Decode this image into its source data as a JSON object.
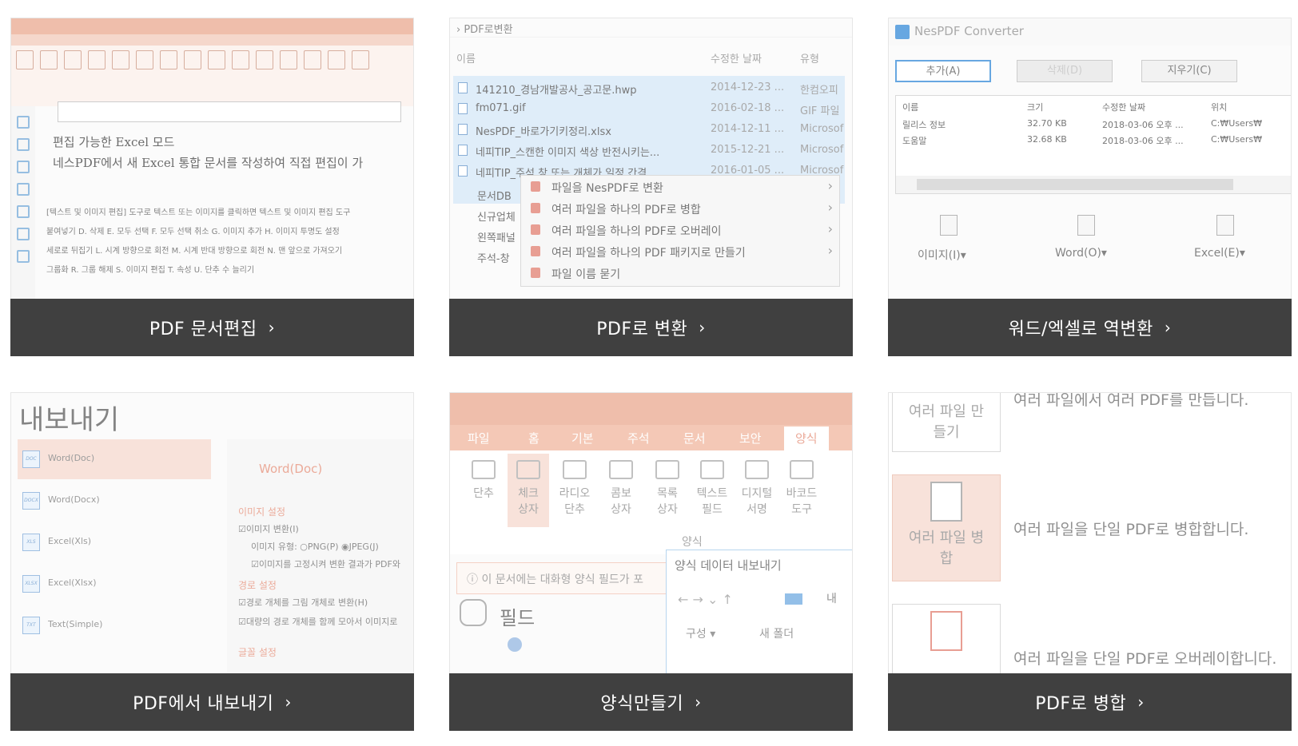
{
  "cards": [
    {
      "label": "PDF 문서편집"
    },
    {
      "label": "PDF로 변환"
    },
    {
      "label": "워드/엑셀로 역변환"
    },
    {
      "label": "PDF에서 내보내기"
    },
    {
      "label": "양식만들기"
    },
    {
      "label": "PDF로 병합"
    }
  ],
  "chevron": "›",
  "editor": {
    "heading1": "편집 가능한 Excel 모드",
    "heading2": "네스PDF에서 새 Excel 통합 문서를 작성하여 직접 편집이 가",
    "lines": [
      "[텍스트 및 이미지 편집] 도구로 텍스트 또는 이미지를 클릭하면 텍스트 및 이미지 편집 도구",
      "붙여넣기 D. 삭제 E. 모두 선택 F. 모두 선택 취소 G. 이미지 추가 H. 이미지 투명도 설정",
      "세로로 뒤집기 L. 시계 방향으로 회전 M. 시계 반대 방향으로 회전 N. 맨 앞으로 가져오기",
      "그룹화 R. 그룹 해제 S. 이미지 편집 T. 속성 U. 단추 수 늘리기"
    ]
  },
  "explorer": {
    "breadcrumb": "PDF로변환",
    "col_name": "이름",
    "col_date": "수정한 날짜",
    "col_type": "유형",
    "files": [
      {
        "name": "141210_경남개발공사_공고문.hwp",
        "date": "2014-12-23 ...",
        "type": "한컴오피"
      },
      {
        "name": "fm071.gif",
        "date": "2016-02-18 ...",
        "type": "GIF 파일"
      },
      {
        "name": "NesPDF_바로가기키정리.xlsx",
        "date": "2014-12-11 ...",
        "type": "Microsof"
      },
      {
        "name": "네피TIP_스캔한 이미지 색상 반전시키는...",
        "date": "2015-12-21 ...",
        "type": "Microsof"
      },
      {
        "name": "네피TIP_주석 창 또는 개체가 일정 간격...",
        "date": "2016-01-05 ...",
        "type": "Microsof"
      }
    ],
    "left_names": [
      "문서DB",
      "신규업체",
      "왼쪽패널",
      "주석-창"
    ],
    "menu": [
      "파일을 NesPDF로 변환",
      "여러 파일을 하나의 PDF로 병합",
      "여러 파일을 하나의 PDF로 오버레이",
      "여러 파일을 하나의 PDF 패키지로 만들기",
      "파일 이름 묻기"
    ]
  },
  "converter": {
    "title": "NesPDF Converter",
    "btn_add": "추가(A)",
    "btn_delete": "삭제(D)",
    "btn_clear": "지우기(C)",
    "col_name": "이름",
    "col_size": "크기",
    "col_date": "수정한 날짜",
    "col_loc": "위치",
    "rows": [
      {
        "name": "릴리스 정보",
        "size": "32.70 KB",
        "date": "2018-03-06 오후 ...",
        "loc": "C:₩Users₩"
      },
      {
        "name": "도움말",
        "size": "32.68 KB",
        "date": "2018-03-06 오후 ...",
        "loc": "C:₩Users₩"
      }
    ],
    "out_image": "이미지(I)▾",
    "out_word": "Word(O)▾",
    "out_excel": "Excel(E)▾"
  },
  "export": {
    "title": "내보내기",
    "formats": [
      "Word(Doc)",
      "Word(Docx)",
      "Excel(Xls)",
      "Excel(Xlsx)",
      "Text(Simple)"
    ],
    "format_icons": [
      "DOC",
      "DOCX",
      "XLS",
      "XLSX",
      "TXT"
    ],
    "selected_format": "Word(Doc)",
    "sec_image": "이미지 설정",
    "opt_image_convert": "☑이미지 변환(I)",
    "opt_image_type": "이미지 유형:  ○PNG(P)   ◉JPEG(J)",
    "opt_image_fix": "☑이미지를 고정시켜 변환 결과가 PDF와",
    "sec_path": "경로 설정",
    "opt_path_convert": "☑경로 개체를 그림 개체로 변환(H)",
    "opt_path_merge": "☑대량의 경로 개체를 함께 모아서 이미지로",
    "sec_font": "글꼴 설정"
  },
  "forms": {
    "tabs": [
      "파일",
      "홈",
      "기본",
      "주석",
      "문서",
      "보안",
      "양식"
    ],
    "tools": [
      "단추",
      "체크\n상자",
      "라디오\n단추",
      "콤보\n상자",
      "목록\n상자",
      "텍스트\n필드",
      "디지털\n서명",
      "바코드\n도구"
    ],
    "group": "양식",
    "info": "ⓘ 이 문서에는 대화형 양식 필드가 포",
    "dialog_title": "양식 데이터 내보내기",
    "dialog_nav": "←  →  ⌄  ↑",
    "dialog_path": "내",
    "dialog_org": "구성 ▾",
    "dialog_new": "새 폴더",
    "field": "필드"
  },
  "merge": {
    "item_create": "여러 파일 만\n들기",
    "item_merge": "여러 파일 병\n합",
    "desc_create": "여러 파일에서 여러 PDF를 만듭니다.",
    "desc_merge": "여러 파일을 단일 PDF로 병합합니다.",
    "desc_overlay": "여러 파일을 단일 PDF로 오버레이합니다."
  }
}
